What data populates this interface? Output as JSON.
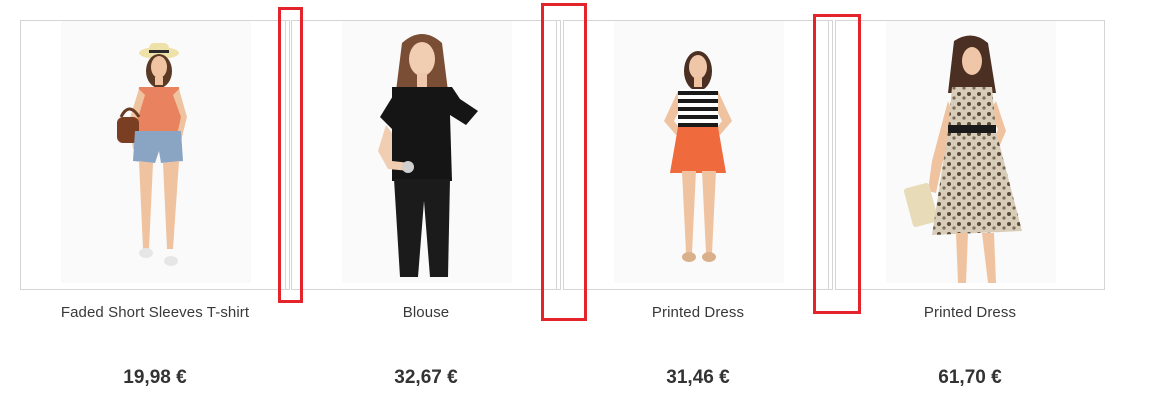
{
  "products": [
    {
      "name": "Faded Short Sleeves T-shirt",
      "price": "19,98 €",
      "image": "woman-in-coral-top-and-denim-shorts"
    },
    {
      "name": "Blouse",
      "price": "32,67 €",
      "image": "woman-in-black-ruffle-blouse"
    },
    {
      "name": "Printed Dress",
      "price": "31,46 €",
      "image": "woman-in-striped-top-and-orange-skirt"
    },
    {
      "name": "Printed Dress",
      "price": "61,70 €",
      "image": "woman-in-printed-chiffon-dress"
    }
  ],
  "colors": {
    "marker": "#e3242b",
    "border": "#d6d4d4",
    "price": "#333333",
    "name": "#3a3939"
  }
}
